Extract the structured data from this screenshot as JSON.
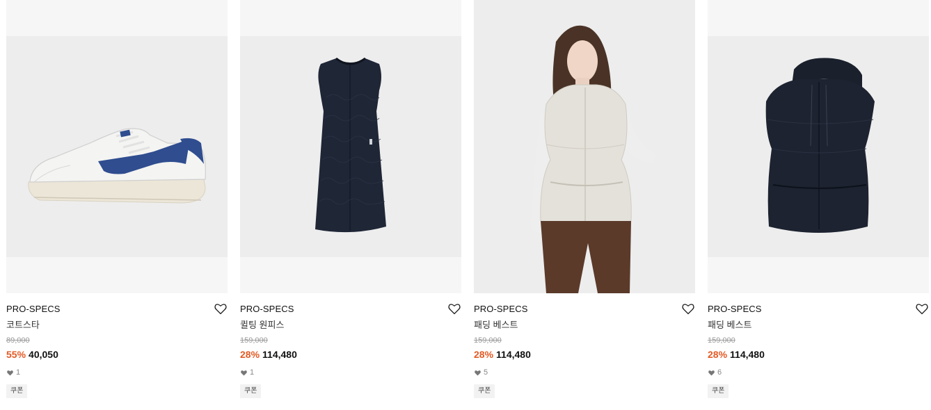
{
  "products": [
    {
      "brand": "PRO-SPECS",
      "name": "코트스타",
      "original_price": "89,000",
      "discount": "55%",
      "price": "40,050",
      "likes": "1",
      "coupon": "쿠폰",
      "image": "sneaker",
      "accent": "#2d4a8a"
    },
    {
      "brand": "PRO-SPECS",
      "name": "퀼팅 원피스",
      "original_price": "159,000",
      "discount": "28%",
      "price": "114,480",
      "likes": "1",
      "coupon": "쿠폰",
      "image": "quilted-dress",
      "accent": "#1e2533"
    },
    {
      "brand": "PRO-SPECS",
      "name": "패딩 베스트",
      "original_price": "159,000",
      "discount": "28%",
      "price": "114,480",
      "likes": "5",
      "coupon": "쿠폰",
      "image": "model-padded-vest",
      "accent": "#e4e1da"
    },
    {
      "brand": "PRO-SPECS",
      "name": "패딩 베스트",
      "original_price": "159,000",
      "discount": "28%",
      "price": "114,480",
      "likes": "6",
      "coupon": "쿠폰",
      "image": "hooded-padded-vest",
      "accent": "#1d2330"
    }
  ],
  "colors": {
    "discount": "#e35a25",
    "background": "#ffffff",
    "thumb_bg": "#f6f6f6"
  }
}
